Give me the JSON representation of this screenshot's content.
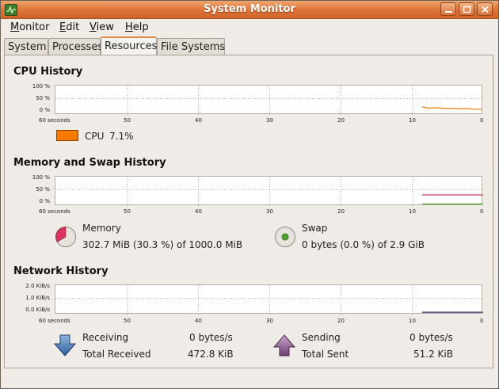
{
  "window": {
    "title": "System Monitor"
  },
  "menu": {
    "items": [
      {
        "label": "Monitor",
        "mnemonic": "M",
        "rest": "onitor"
      },
      {
        "label": "Edit",
        "mnemonic": "E",
        "rest": "dit"
      },
      {
        "label": "View",
        "mnemonic": "V",
        "rest": "iew"
      },
      {
        "label": "Help",
        "mnemonic": "H",
        "rest": "elp"
      }
    ]
  },
  "tabs": [
    {
      "label": "System",
      "active": false
    },
    {
      "label": "Processes",
      "active": false
    },
    {
      "label": "Resources",
      "active": true
    },
    {
      "label": "File Systems",
      "active": false
    }
  ],
  "x_ticks": [
    "60 seconds",
    "50",
    "40",
    "30",
    "20",
    "10",
    "0"
  ],
  "cpu": {
    "title": "CPU History",
    "y_ticks": [
      "100 %",
      "50 %",
      "0 %"
    ],
    "legend_label": "CPU",
    "legend_value": "7.1%",
    "color": "#f57900"
  },
  "memory": {
    "title": "Memory and Swap History",
    "y_ticks": [
      "100 %",
      "50 %",
      "0 %"
    ],
    "memory_label": "Memory",
    "memory_value": "302.7 MiB (30.3 %) of 1000.0 MiB",
    "memory_color": "#d8345f",
    "swap_label": "Swap",
    "swap_value": "0 bytes (0.0 %) of 2.9 GiB",
    "swap_color": "#4ea32e"
  },
  "network": {
    "title": "Network History",
    "y_ticks": [
      "2.0 KiB/s",
      "1.0 KiB/s",
      "0.0 KiB/s"
    ],
    "receiving_label": "Receiving",
    "receiving_value": "0 bytes/s",
    "total_received_label": "Total Received",
    "total_received_value": "472.8 KiB",
    "sending_label": "Sending",
    "sending_value": "0 bytes/s",
    "total_sent_label": "Total Sent",
    "total_sent_value": "51.2 KiB",
    "receive_color": "#3465a4",
    "send_color": "#75507b"
  }
}
